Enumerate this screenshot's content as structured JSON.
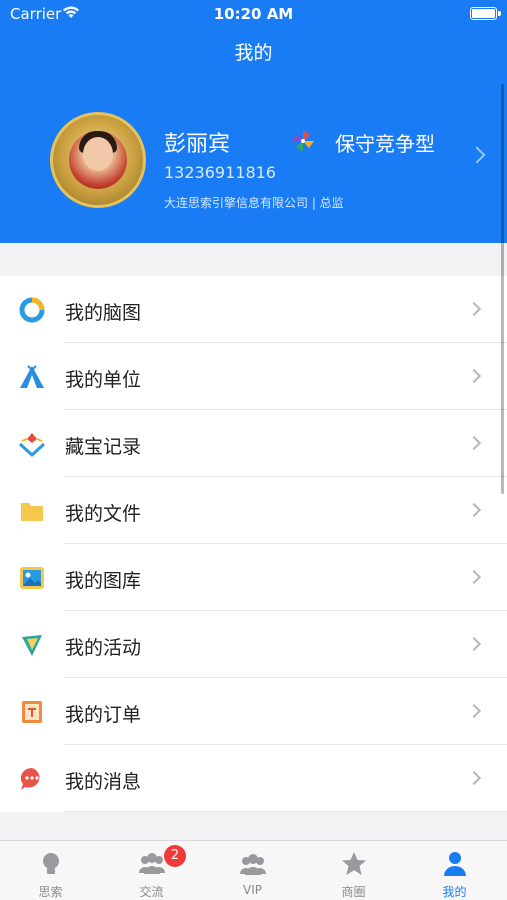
{
  "status_bar": {
    "carrier": "Carrier",
    "time": "10:20 AM"
  },
  "nav": {
    "title": "我的"
  },
  "profile": {
    "name": "彭丽宾",
    "persona": "保守竞争型",
    "phone": "13236911816",
    "company": "大连思索引擎信息有限公司 | 总监"
  },
  "menu": {
    "items": [
      {
        "label": "我的脑图",
        "icon": "mindmap-icon"
      },
      {
        "label": "我的单位",
        "icon": "tent-icon"
      },
      {
        "label": "藏宝记录",
        "icon": "treasure-icon"
      },
      {
        "label": "我的文件",
        "icon": "folder-icon"
      },
      {
        "label": "我的图库",
        "icon": "gallery-icon"
      },
      {
        "label": "我的活动",
        "icon": "flag-icon"
      },
      {
        "label": "我的订单",
        "icon": "order-icon"
      },
      {
        "label": "我的消息",
        "icon": "message-icon"
      }
    ]
  },
  "tabbar": {
    "tabs": [
      {
        "label": "思索",
        "icon": "bulb-icon"
      },
      {
        "label": "交流",
        "icon": "group-icon",
        "badge": "2"
      },
      {
        "label": "VIP",
        "icon": "vip-group-icon"
      },
      {
        "label": "商圈",
        "icon": "star-icon"
      },
      {
        "label": "我的",
        "icon": "person-icon",
        "active": true
      }
    ]
  },
  "colors": {
    "accent": "#1a7cf5",
    "badge": "#f03a3a"
  }
}
